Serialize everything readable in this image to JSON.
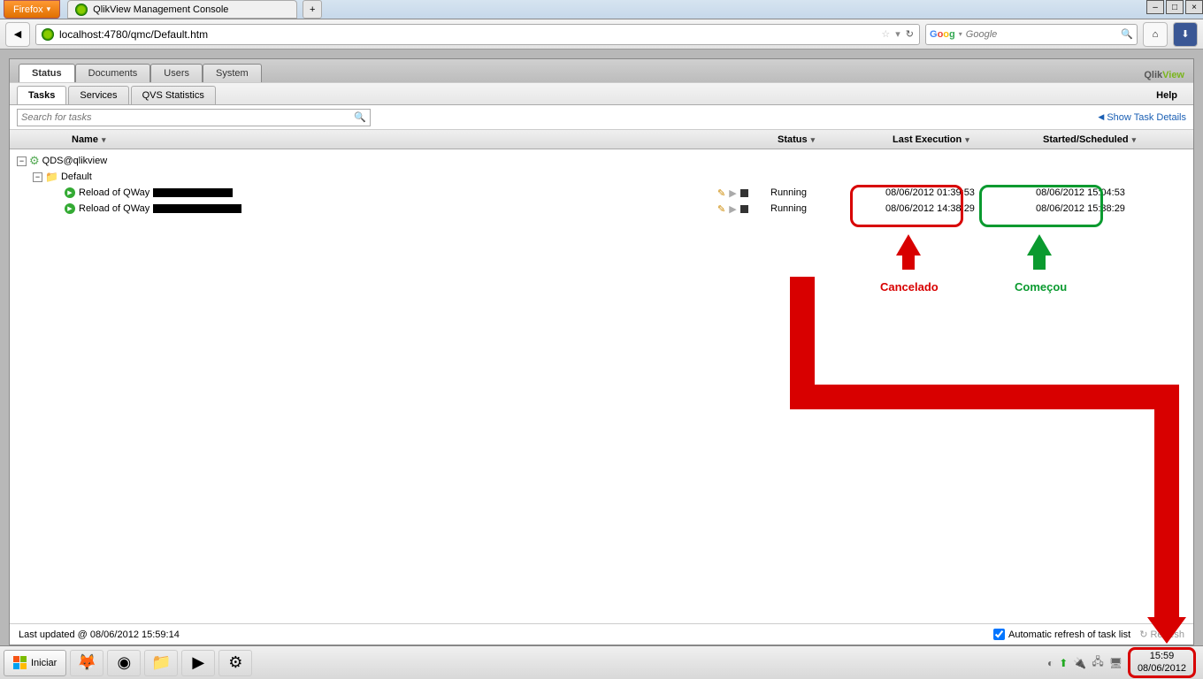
{
  "browser": {
    "app_button": "Firefox",
    "tab_title": "QlikView Management Console",
    "url": "localhost:4780/qmc/Default.htm",
    "search_placeholder": "Google"
  },
  "mainTabs": [
    "Status",
    "Documents",
    "Users",
    "System"
  ],
  "mainTabActive": 0,
  "subTabs": [
    "Tasks",
    "Services",
    "QVS Statistics"
  ],
  "subTabActive": 0,
  "helpLabel": "Help",
  "searchPlaceholder": "Search for tasks",
  "showDetails": "Show Task Details",
  "columns": {
    "name": "Name",
    "status": "Status",
    "last": "Last Execution",
    "sched": "Started/Scheduled"
  },
  "tree": {
    "root": "QDS@qlikview",
    "folder": "Default"
  },
  "tasks": [
    {
      "name": "Reload of QWay",
      "status": "Running",
      "last": "08/06/2012 01:39:53",
      "sched": "08/06/2012 15:04:53"
    },
    {
      "name": "Reload of QWay",
      "status": "Running",
      "last": "08/06/2012 14:38:29",
      "sched": "08/06/2012 15:38:29"
    }
  ],
  "footer": {
    "lastUpdated": "Last updated @ 08/06/2012 15:59:14",
    "autoRefresh": "Automatic refresh of task list",
    "refresh": "Refresh"
  },
  "annotations": {
    "cancelado": "Cancelado",
    "comecou": "Começou"
  },
  "taskbar": {
    "start": "Iniciar",
    "clock_time": "15:59",
    "clock_date": "08/06/2012"
  },
  "logo": {
    "part1": "Qlik",
    "part2": "View"
  }
}
